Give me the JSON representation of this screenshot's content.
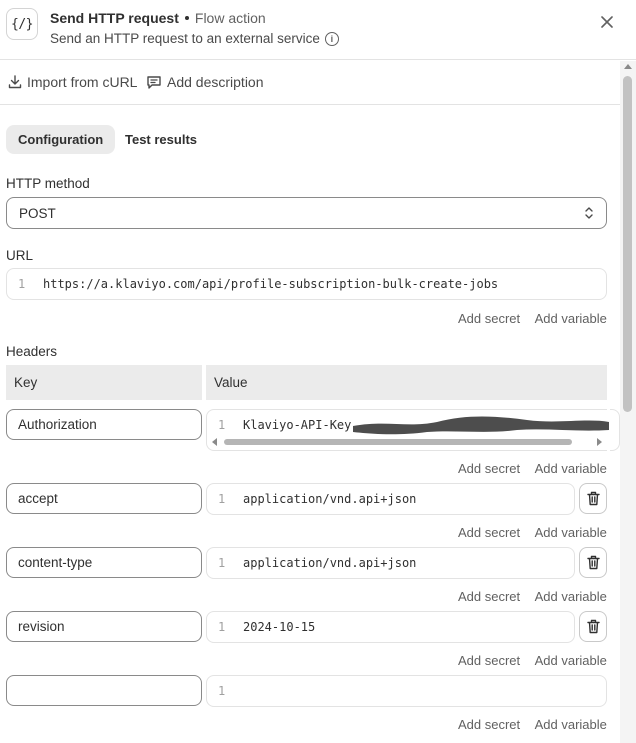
{
  "header": {
    "icon_text": "{/}",
    "title": "Send HTTP request",
    "type": "Flow action",
    "subtitle": "Send an HTTP request to an external service",
    "info_icon": "info-icon",
    "close_icon": "close-icon"
  },
  "actions": {
    "import_curl": "Import from cURL",
    "add_description": "Add description"
  },
  "tabs": [
    {
      "label": "Configuration",
      "active": true
    },
    {
      "label": "Test results",
      "active": false
    }
  ],
  "http_method": {
    "label": "HTTP method",
    "value": "POST"
  },
  "url": {
    "label": "URL",
    "line_number": "1",
    "value": "https://a.klaviyo.com/api/profile-subscription-bulk-create-jobs"
  },
  "links": {
    "add_secret": "Add secret",
    "add_variable": "Add variable"
  },
  "headers": {
    "label": "Headers",
    "col_key": "Key",
    "col_value": "Value",
    "rows": [
      {
        "key": "Authorization",
        "line": "1",
        "value": "Klaviyo-API-Key"
      },
      {
        "key": "accept",
        "line": "1",
        "value": "application/vnd.api+json"
      },
      {
        "key": "content-type",
        "line": "1",
        "value": "application/vnd.api+json"
      },
      {
        "key": "revision",
        "line": "1",
        "value": "2024-10-15"
      },
      {
        "key": "",
        "line": "1",
        "value": ""
      }
    ]
  },
  "colors": {
    "border": "#8a8a8a",
    "light_border": "#e3e3e3",
    "header_bg": "#ebebeb",
    "redaction": "#4d4d4d"
  }
}
